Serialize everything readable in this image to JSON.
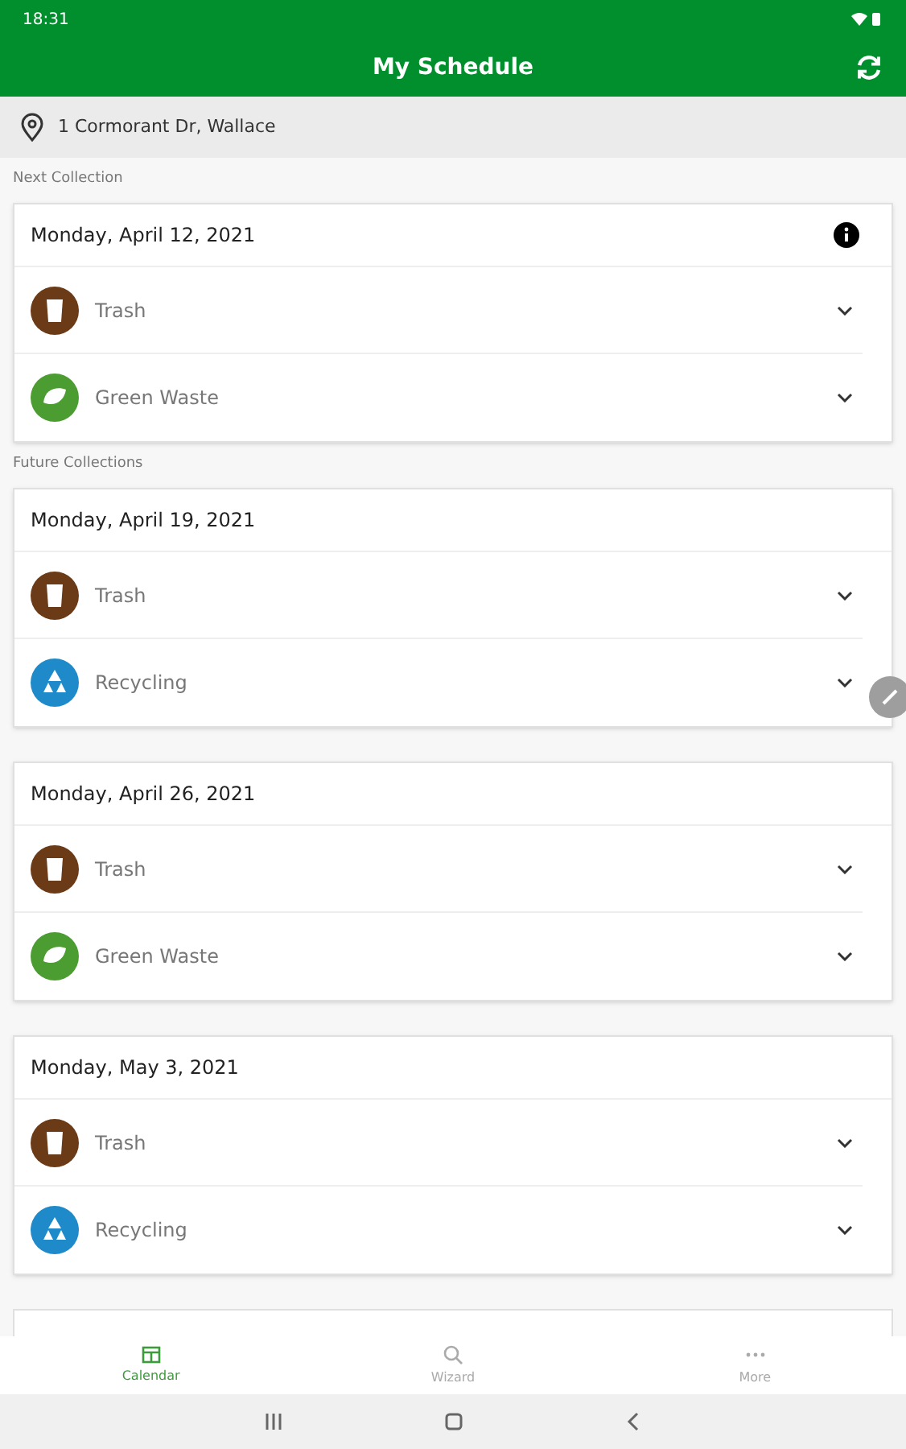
{
  "status_bar": {
    "time": "18:31"
  },
  "header": {
    "title": "My Schedule"
  },
  "address": "1 Cormorant Dr, Wallace",
  "next": {
    "label": "Next Collection",
    "date": "Monday, April 12, 2021",
    "items": [
      {
        "kind": "trash",
        "label": "Trash"
      },
      {
        "kind": "green_waste",
        "label": "Green Waste"
      }
    ]
  },
  "future": {
    "label": "Future Collections",
    "days": [
      {
        "date": "Monday, April 19, 2021",
        "items": [
          {
            "kind": "trash",
            "label": "Trash"
          },
          {
            "kind": "recycling",
            "label": "Recycling"
          }
        ]
      },
      {
        "date": "Monday, April 26, 2021",
        "items": [
          {
            "kind": "trash",
            "label": "Trash"
          },
          {
            "kind": "green_waste",
            "label": "Green Waste"
          }
        ]
      },
      {
        "date": "Monday, May 3, 2021",
        "items": [
          {
            "kind": "trash",
            "label": "Trash"
          },
          {
            "kind": "recycling",
            "label": "Recycling"
          }
        ]
      }
    ]
  },
  "tabs": [
    {
      "label": "Calendar",
      "selected": true
    },
    {
      "label": "Wizard",
      "selected": false
    },
    {
      "label": "More",
      "selected": false
    }
  ]
}
